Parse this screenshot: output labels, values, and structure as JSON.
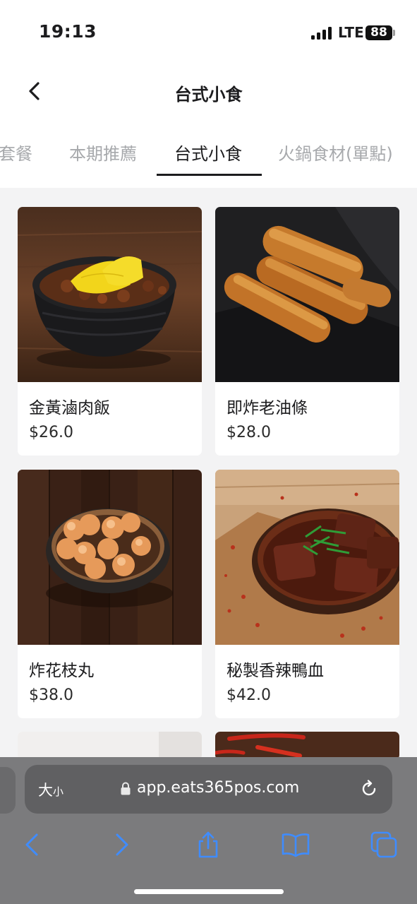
{
  "status_bar": {
    "time": "19:13",
    "network": "LTE",
    "battery": "88"
  },
  "header": {
    "title": "台式小食",
    "back_icon": "chevron-left-icon"
  },
  "tabs": [
    {
      "label": "套餐",
      "active": false
    },
    {
      "label": "本期推薦",
      "active": false
    },
    {
      "label": "台式小食",
      "active": true
    },
    {
      "label": "火鍋食材(單點)",
      "active": false
    }
  ],
  "products": [
    {
      "name": "金黃滷肉飯",
      "price": "$26.0"
    },
    {
      "name": "即炸老油條",
      "price": "$28.0"
    },
    {
      "name": "炸花枝丸",
      "price": "$38.0"
    },
    {
      "name": "秘製香辣鴨血",
      "price": "$42.0"
    }
  ],
  "browser": {
    "text_size_big": "大",
    "text_size_small": "小",
    "url": "app.eats365pos.com",
    "icons": [
      "lock-icon",
      "reload-icon",
      "back-arrow-icon",
      "forward-arrow-icon",
      "share-icon",
      "bookmarks-icon",
      "tabs-icon"
    ],
    "accent_color": "#3f8cff"
  }
}
